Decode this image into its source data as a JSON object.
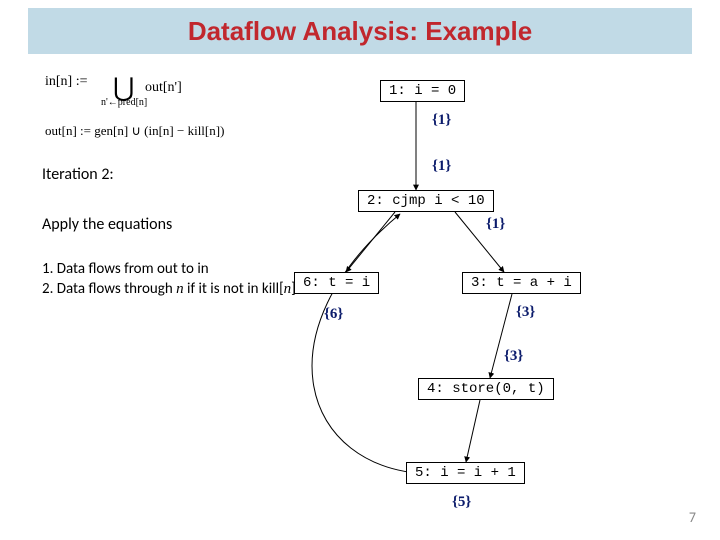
{
  "title": "Dataflow Analysis: Example",
  "equations": {
    "in_lhs": "in[n] :=",
    "bigcup": "⋃",
    "cup_sub": "n'←pred[n]",
    "in_rhs": "out[n']",
    "out": "out[n] := gen[n] ∪ (in[n] − kill[n])"
  },
  "iteration": "Iteration 2:",
  "apply": "Apply the equations",
  "rule1": "1. Data flows from out to in",
  "rule2a": "2. Data flows through ",
  "rule2_var": "n",
  "rule2b": " if it is not in kill[",
  "rule2_var2": "n",
  "rule2c": "]",
  "nodes": {
    "n1": "1: i = 0",
    "n2": "2: cjmp i < 10",
    "n3": "3: t = a + i",
    "n4": "4: store(0, t)",
    "n5": "5: i = i + 1",
    "n6": "6: t = i"
  },
  "dsets": {
    "d1a": "{1}",
    "d1b": "{1}",
    "d2": "{1}",
    "d3a": "{3}",
    "d3b": "{3}",
    "d5": "{5}",
    "d6": "{6}"
  },
  "page": "7",
  "chart_data": {
    "type": "diagram",
    "description": "Control-flow graph with reaching-definition sets after iteration 2",
    "nodes": [
      {
        "id": 1,
        "label": "i = 0"
      },
      {
        "id": 2,
        "label": "cjmp i < 10"
      },
      {
        "id": 3,
        "label": "t = a + i"
      },
      {
        "id": 4,
        "label": "store(0, t)"
      },
      {
        "id": 5,
        "label": "i = i + 1"
      },
      {
        "id": 6,
        "label": "t = i"
      }
    ],
    "edges": [
      {
        "from": 1,
        "to": 2
      },
      {
        "from": 2,
        "to": 3
      },
      {
        "from": 2,
        "to": 6
      },
      {
        "from": 3,
        "to": 4
      },
      {
        "from": 4,
        "to": 5
      },
      {
        "from": 5,
        "to": 2
      }
    ],
    "out_sets_iteration2": {
      "1": [
        1
      ],
      "2": [
        1
      ],
      "3": [
        3
      ],
      "5": [
        5
      ],
      "6": [
        6
      ]
    }
  }
}
